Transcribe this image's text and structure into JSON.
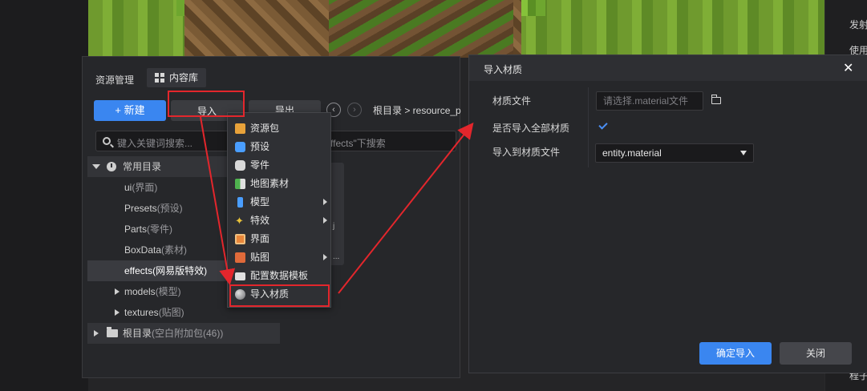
{
  "right_strip": {
    "label_1": "发射",
    "label_2": "使用",
    "label_3": "程子"
  },
  "resource_manager": {
    "title": "资源管理",
    "tab_library": "内容库",
    "new_button": "+ 新建",
    "import_button": "导入",
    "export_button": "导出",
    "breadcrumb": "根目录 > resource_p",
    "search_placeholder": "键入关键词搜索...",
    "search_scope": "ffects\"下搜索",
    "tree": {
      "common_dir": "常用目录",
      "items": [
        {
          "name": "ui",
          "note": "(界面)"
        },
        {
          "name": "Presets",
          "note": "(预设)"
        },
        {
          "name": "Parts",
          "note": "(零件)"
        },
        {
          "name": "BoxData",
          "note": "(素材)"
        },
        {
          "name": "effects",
          "note": "(网易版特效)"
        },
        {
          "name": "models",
          "note": "(模型)"
        },
        {
          "name": "textures",
          "note": "(贴图)"
        }
      ],
      "root_dir": "根目录",
      "root_note": "(空白附加包(46))"
    },
    "side_card_a": "j",
    "side_card_b": "..."
  },
  "import_menu": [
    {
      "label": "资源包",
      "icon": "package-icon",
      "color": "#e8a23a",
      "submenu": false
    },
    {
      "label": "预设",
      "icon": "hexagon-icon",
      "color": "#4a9eff",
      "submenu": false
    },
    {
      "label": "零件",
      "icon": "puzzle-icon",
      "color": "#d8d8d8",
      "submenu": false
    },
    {
      "label": "地图素材",
      "icon": "map-icon",
      "color": "#4fb34f",
      "submenu": false
    },
    {
      "label": "模型",
      "icon": "figure-icon",
      "color": "#4a9eff",
      "submenu": true
    },
    {
      "label": "特效",
      "icon": "sparkle-icon",
      "color": "#e8c23a",
      "submenu": true
    },
    {
      "label": "界面",
      "icon": "window-icon",
      "color": "#e8863a",
      "submenu": false
    },
    {
      "label": "贴图",
      "icon": "image-icon",
      "color": "#e06a3a",
      "submenu": true
    },
    {
      "label": "配置数据模板",
      "icon": "folder-icon",
      "color": "#e0e0e0",
      "submenu": false
    },
    {
      "label": "导入材质",
      "icon": "sphere-icon",
      "color": "#9a9a9e",
      "submenu": false
    }
  ],
  "dialog": {
    "title": "导入材质",
    "close_glyph": "✕",
    "material_file_label": "材质文件",
    "material_file_placeholder": "请选择.material文件",
    "import_all_label": "是否导入全部材质",
    "import_all_checked": true,
    "target_label": "导入到材质文件",
    "target_value": "entity.material",
    "confirm_button": "确定导入",
    "close_button": "关闭"
  },
  "colors": {
    "accent": "#3a86f0",
    "annotation": "#e3262c"
  }
}
